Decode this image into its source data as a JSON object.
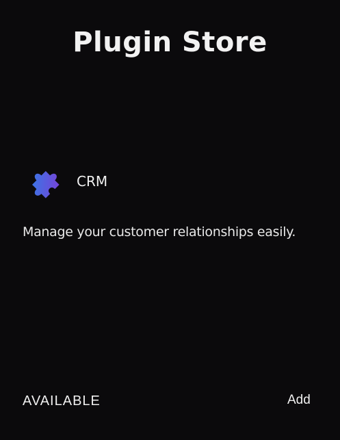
{
  "header": {
    "title": "Plugin Store"
  },
  "plugin": {
    "name": "CRM",
    "description": "Manage your customer relationships easily.",
    "icon": "puzzle-piece-icon",
    "status": "AVAILABLE",
    "action_label": "Add"
  },
  "colors": {
    "background": "#0b0a0c",
    "text": "#f0f0f0",
    "icon_gradient_start": "#2f7fe8",
    "icon_gradient_end": "#7b3fd6"
  }
}
